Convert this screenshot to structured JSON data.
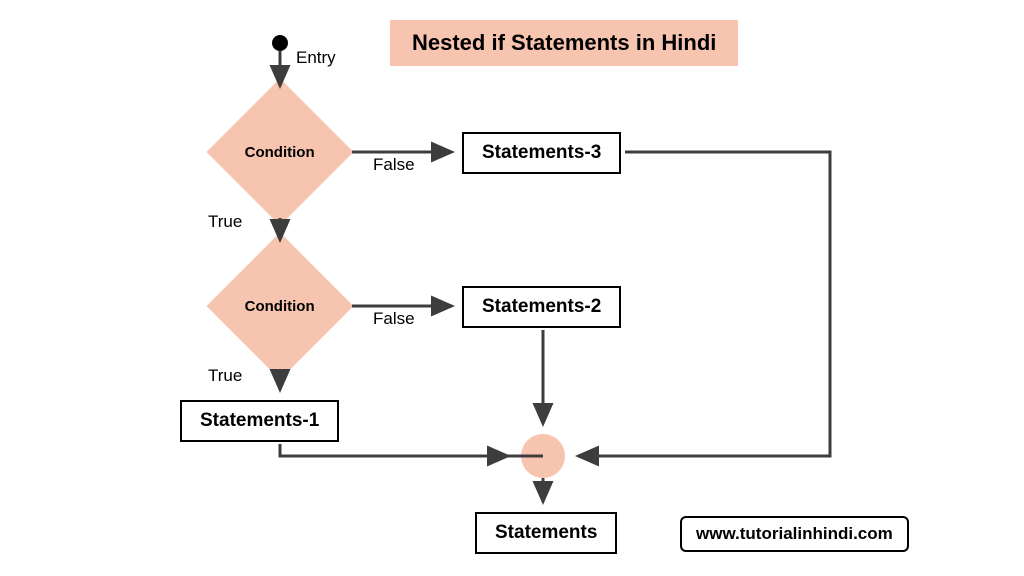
{
  "title": "Nested if Statements in Hindi",
  "flow": {
    "entry_label": "Entry",
    "cond1": "Condition",
    "cond2": "Condition",
    "true1": "True",
    "true2": "True",
    "false1": "False",
    "false2": "False",
    "stm1": "Statements-1",
    "stm2": "Statements-2",
    "stm3": "Statements-3",
    "final": "Statements"
  },
  "branding": "www.tutorialinhindi.com"
}
